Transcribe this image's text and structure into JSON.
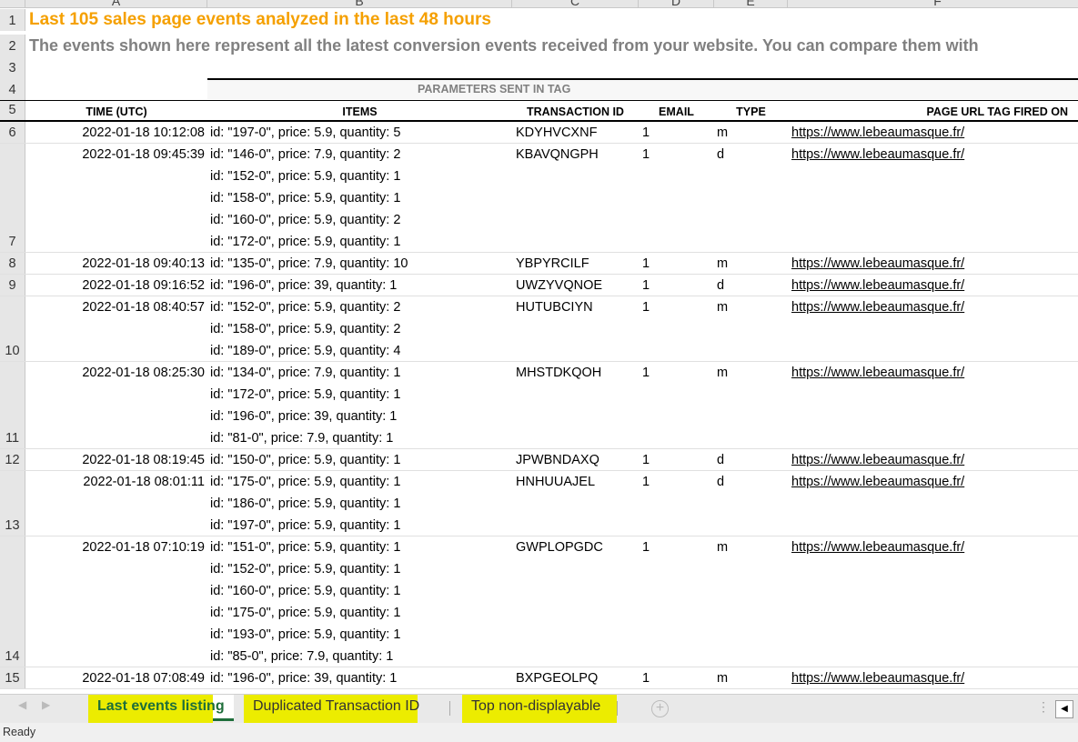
{
  "columns": [
    "A",
    "B",
    "C",
    "D",
    "E",
    "F"
  ],
  "title": "Last 105 sales page events analyzed in the last 48 hours",
  "subtitle": "The events shown here represent all the latest conversion events received from your website. You can compare them with",
  "group_header": "PARAMETERS SENT IN TAG",
  "headers": {
    "time": "TIME (UTC)",
    "items": "ITEMS",
    "transaction_id": "TRANSACTION ID",
    "email": "EMAIL",
    "type": "TYPE",
    "url": "PAGE URL TAG FIRED ON"
  },
  "header_row_numbers": [
    "1",
    "2",
    "3",
    "4",
    "5"
  ],
  "rows": [
    {
      "num": "6",
      "time": "2022-01-18 10:12:08",
      "items": [
        "id: \"197-0\", price: 5.9, quantity: 5"
      ],
      "tx": "KDYHVCXNF",
      "email": "1",
      "type": "m",
      "url": "https://www.lebeaumasque.fr/"
    },
    {
      "num": "7",
      "time": "2022-01-18 09:45:39",
      "items": [
        "id: \"146-0\", price: 7.9, quantity: 2",
        "id: \"152-0\", price: 5.9, quantity: 1",
        "id: \"158-0\", price: 5.9, quantity: 1",
        "id: \"160-0\", price: 5.9, quantity: 2",
        "id: \"172-0\", price: 5.9, quantity: 1"
      ],
      "tx": "KBAVQNGPH",
      "email": "1",
      "type": "d",
      "url": "https://www.lebeaumasque.fr/"
    },
    {
      "num": "8",
      "time": "2022-01-18 09:40:13",
      "items": [
        "id: \"135-0\", price: 7.9, quantity: 10"
      ],
      "tx": "YBPYRCILF",
      "email": "1",
      "type": "m",
      "url": "https://www.lebeaumasque.fr/"
    },
    {
      "num": "9",
      "time": "2022-01-18 09:16:52",
      "items": [
        "id: \"196-0\", price: 39, quantity: 1"
      ],
      "tx": "UWZYVQNOE",
      "email": "1",
      "type": "d",
      "url": "https://www.lebeaumasque.fr/"
    },
    {
      "num": "10",
      "time": "2022-01-18 08:40:57",
      "items": [
        "id: \"152-0\", price: 5.9, quantity: 2",
        "id: \"158-0\", price: 5.9, quantity: 2",
        "id: \"189-0\", price: 5.9, quantity: 4"
      ],
      "tx": "HUTUBCIYN",
      "email": "1",
      "type": "m",
      "url": "https://www.lebeaumasque.fr/"
    },
    {
      "num": "11",
      "time": "2022-01-18 08:25:30",
      "items": [
        "id: \"134-0\", price: 7.9, quantity: 1",
        "id: \"172-0\", price: 5.9, quantity: 1",
        "id: \"196-0\", price: 39, quantity: 1",
        "id: \"81-0\", price: 7.9, quantity: 1"
      ],
      "tx": "MHSTDKQOH",
      "email": "1",
      "type": "m",
      "url": "https://www.lebeaumasque.fr/"
    },
    {
      "num": "12",
      "time": "2022-01-18 08:19:45",
      "items": [
        "id: \"150-0\", price: 5.9, quantity: 1"
      ],
      "tx": "JPWBNDAXQ",
      "email": "1",
      "type": "d",
      "url": "https://www.lebeaumasque.fr/"
    },
    {
      "num": "13",
      "time": "2022-01-18 08:01:11",
      "items": [
        "id: \"175-0\", price: 5.9, quantity: 1",
        "id: \"186-0\", price: 5.9, quantity: 1",
        "id: \"197-0\", price: 5.9, quantity: 1"
      ],
      "tx": "HNHUUAJEL",
      "email": "1",
      "type": "d",
      "url": "https://www.lebeaumasque.fr/"
    },
    {
      "num": "14",
      "time": "2022-01-18 07:10:19",
      "items": [
        "id: \"151-0\", price: 5.9, quantity: 1",
        "id: \"152-0\", price: 5.9, quantity: 1",
        "id: \"160-0\", price: 5.9, quantity: 1",
        "id: \"175-0\", price: 5.9, quantity: 1",
        "id: \"193-0\", price: 5.9, quantity: 1",
        "id: \"85-0\", price: 7.9, quantity: 1"
      ],
      "tx": "GWPLOPGDC",
      "email": "1",
      "type": "m",
      "url": "https://www.lebeaumasque.fr/"
    },
    {
      "num": "15",
      "time": "2022-01-18 07:08:49",
      "items": [
        "id: \"196-0\", price: 39, quantity: 1"
      ],
      "tx": "BXPGEOLPQ",
      "email": "1",
      "type": "m",
      "url": "https://www.lebeaumasque.fr/"
    }
  ],
  "tabs": [
    {
      "label": "Last events listing",
      "active": true
    },
    {
      "label": "Duplicated Transaction ID"
    },
    {
      "label": "Top non-displayable"
    }
  ],
  "status": "Ready",
  "colors": {
    "title": "#f5a000",
    "subtitle": "#808080",
    "active_tab": "#1e6e3a",
    "highlight": "#ecec00"
  }
}
